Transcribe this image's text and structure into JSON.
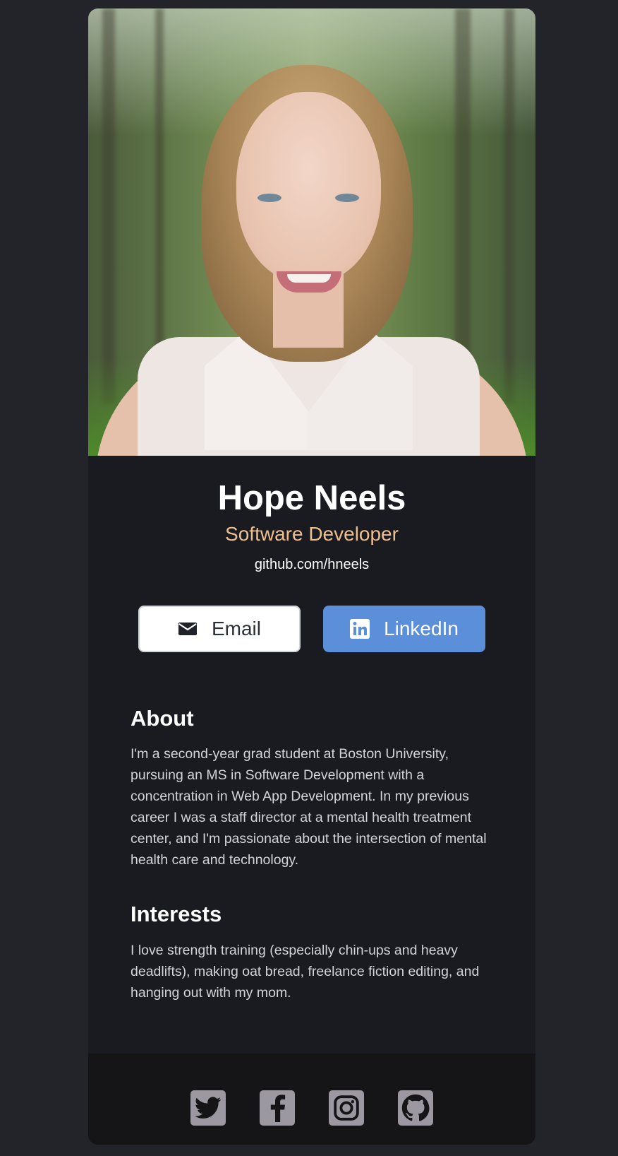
{
  "profile": {
    "name": "Hope Neels",
    "title": "Software Developer",
    "github": "github.com/hneels"
  },
  "buttons": {
    "email": {
      "label": "Email",
      "icon": "envelope-icon"
    },
    "linkedin": {
      "label": "LinkedIn",
      "icon": "linkedin-icon"
    }
  },
  "about": {
    "heading": "About",
    "body": "I'm a second-year grad student at Boston University, pursuing an MS in Software Development with a concentration in Web App Development. In my previous career I was a staff director at a mental health treatment center, and I'm passionate about the intersection of mental health care and technology."
  },
  "interests": {
    "heading": "Interests",
    "body": "I love strength training (especially chin-ups and heavy deadlifts), making oat bread, freelance fiction editing, and hanging out with my mom."
  },
  "footer": {
    "icons": [
      "twitter-icon",
      "facebook-icon",
      "instagram-icon",
      "github-icon"
    ]
  },
  "colors": {
    "page_bg": "#23242a",
    "card_bg": "#1a1b21",
    "footer_bg": "#151517",
    "accent": "#eebf8e",
    "linkedin": "#5b8fd9",
    "social_icon_bg": "#9b98a1"
  }
}
